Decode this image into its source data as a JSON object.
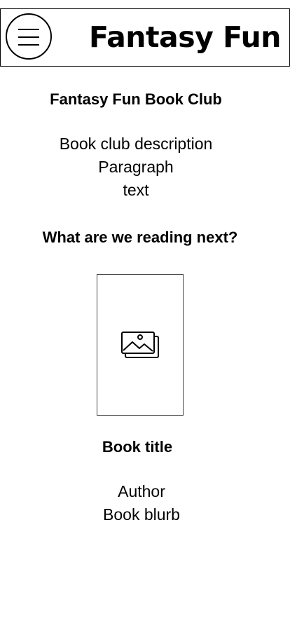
{
  "header": {
    "title": "Fantasy Fun",
    "menu_icon": "hamburger-menu-icon"
  },
  "club": {
    "title": "Fantasy Fun Book Club",
    "description_lines": [
      "Book club description",
      "Paragraph",
      "text"
    ]
  },
  "reading_next": {
    "heading": "What are we reading next?",
    "cover_icon": "image-placeholder-icon",
    "book_title": "Book title",
    "author": "Author",
    "blurb": "Book blurb"
  }
}
